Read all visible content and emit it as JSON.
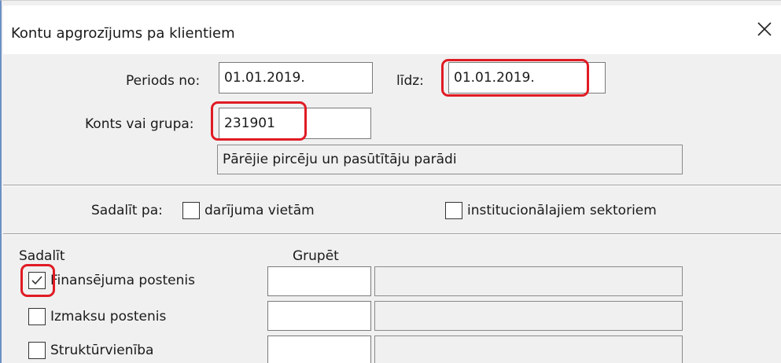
{
  "window": {
    "title": "Kontu apgrozījums pa klientiem",
    "close_icon": "close-icon"
  },
  "period": {
    "from_label": "Periods no:",
    "from_value": "01.01.2019.",
    "to_label": "līdz:",
    "to_value": "01.01.2019."
  },
  "account": {
    "label": "Konts vai grupa:",
    "value": "231901",
    "description": "Pārējie pircēju un pasūtītāju parādi"
  },
  "split_by": {
    "label": "Sadalīt pa:",
    "options": [
      {
        "label": "darījuma vietām",
        "checked": false
      },
      {
        "label": "institucionālajiem sektoriem",
        "checked": false
      }
    ]
  },
  "grouping": {
    "split_header": "Sadalīt",
    "group_header": "Grupēt",
    "rows": [
      {
        "label": "Finansējuma postenis",
        "checked": true,
        "group_value": "",
        "group_description": ""
      },
      {
        "label": "Izmaksu postenis",
        "checked": false,
        "group_value": "",
        "group_description": ""
      },
      {
        "label": "Struktūrvienība",
        "checked": false,
        "group_value": "",
        "group_description": ""
      }
    ]
  },
  "annotation_color": "#e01b24"
}
